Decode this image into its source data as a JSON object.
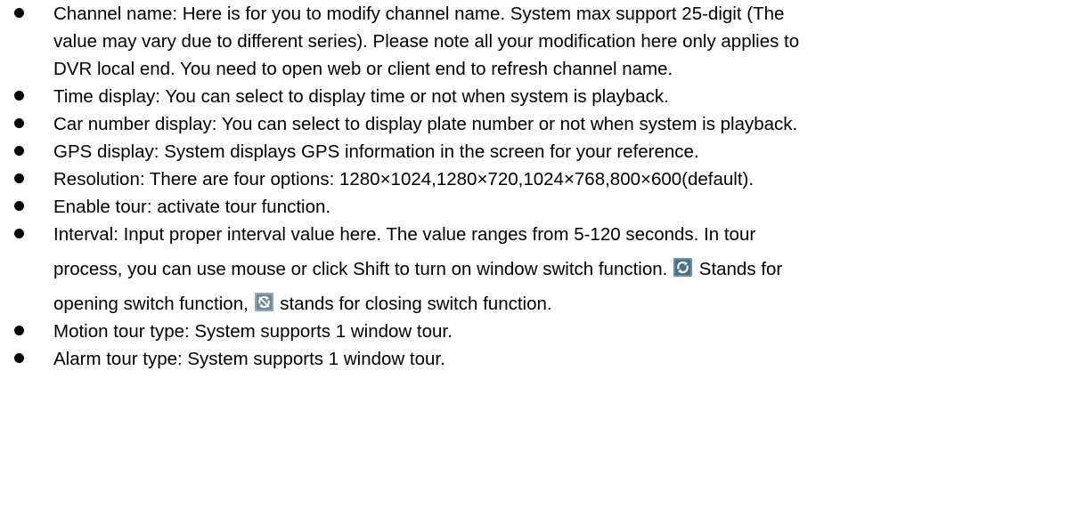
{
  "items": [
    {
      "lines": [
        "Channel name: Here is for you to modify channel name. System max support 25-digit (The",
        "value may vary due to different series). Please note all your modification here only applies to",
        "DVR local end. You need to open web or client end to refresh channel name."
      ]
    },
    {
      "lines": [
        "Time display: You can select to display time or not when system is playback."
      ]
    },
    {
      "lines": [
        "Car number display: You can select to display plate number or not when system is playback."
      ]
    },
    {
      "lines": [
        "GPS display: System displays GPS information in the screen for your reference."
      ]
    },
    {
      "lines": [
        "Resolution: There are four options: 1280×1024,1280×720,1024×768,800×600(default)."
      ]
    },
    {
      "lines": [
        "Enable tour: activate tour function."
      ]
    },
    {
      "line1": "Interval: Input proper interval value here. The value ranges from 5-120 seconds. In tour",
      "line2_before": "process, you can use mouse or click Shift to turn on window switch function.",
      "line2_after": "Stands for",
      "line3_before": "opening switch function,",
      "line3_after": "stands for closing switch function.",
      "icons": [
        "tour-switch-open-icon",
        "tour-switch-close-icon"
      ]
    },
    {
      "lines": [
        "Motion tour type: System supports 1 window tour."
      ]
    },
    {
      "lines": [
        "Alarm tour type: System supports 1 window tour."
      ]
    }
  ],
  "colors": {
    "text": "#000000",
    "icon_open_bg": "#4a6f86",
    "icon_close_bg": "#6c8799"
  }
}
